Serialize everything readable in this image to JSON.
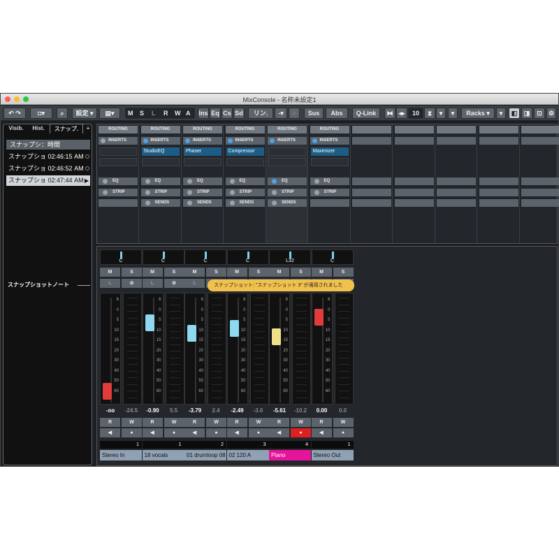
{
  "window": {
    "title": "MixConsole - 名称未設定1"
  },
  "toolbar": {
    "settings": "設定",
    "mode_buttons": [
      "M",
      "S",
      "L",
      "R",
      "W",
      "A"
    ],
    "ins": "Ins",
    "eq": "Eq",
    "cs": "Cs",
    "sd": "Sd",
    "link": "リン.",
    "sus": "Sus",
    "abs": "Abs",
    "qlink": "Q-Link",
    "channels": "10",
    "racks": "Racks"
  },
  "left": {
    "tabs": [
      "Visib.",
      "Hist.",
      "スナップ."
    ],
    "header": "スナップシ：時間",
    "snapshots": [
      {
        "name": "スナップショ",
        "time": "02:46:15 AM"
      },
      {
        "name": "スナップショ",
        "time": "02:46:52 AM"
      },
      {
        "name": "スナップショ",
        "time": "02:47:44 AM"
      }
    ],
    "note_label": "スナップショットノート"
  },
  "rack": {
    "routing": "ROUTING",
    "inserts": "INSERTS",
    "eq": "EQ",
    "strip": "STRIP",
    "sends": "SENDS",
    "plugins": [
      "",
      "StudioEQ",
      "Phaser",
      "Compressor",
      "",
      "Maximizer"
    ]
  },
  "tooltip": "スナップショット: \"スナップショット 3\" が適用されました",
  "channels": [
    {
      "name": "Stereo In",
      "num": "1",
      "pan": "C",
      "vol": "-oo",
      "peak": "-24.5"
    },
    {
      "name": "18 vocals",
      "num": "1",
      "pan": "C",
      "vol": "-0.90",
      "peak": "5.5"
    },
    {
      "name": "01 drumloop 08",
      "num": "2",
      "pan": "C",
      "vol": "-3.79",
      "peak": "2.4"
    },
    {
      "name": "02 120 A",
      "num": "3",
      "pan": "C",
      "vol": "-2.49",
      "peak": "-3.0"
    },
    {
      "name": "Piano",
      "num": "4",
      "pan": "L32",
      "vol": "-5.61",
      "peak": "-10.2"
    },
    {
      "name": "Stereo Out",
      "num": "1",
      "pan": "C",
      "vol": "0.00",
      "peak": "0.0"
    }
  ],
  "scale": [
    "6",
    "0",
    "5",
    "10",
    "15",
    "20",
    "30",
    "40",
    "50",
    "60"
  ],
  "colors": {
    "piano": "#e6149b",
    "accent": "#4ea3e6",
    "tooltip": "#f2c14d"
  }
}
